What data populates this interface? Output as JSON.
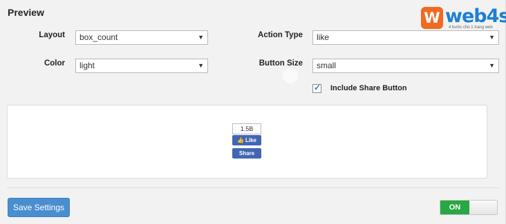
{
  "preview_title": "Preview",
  "logo": {
    "badge": "W",
    "text": "web4s",
    "tagline": "4 bước cho 1 trang web"
  },
  "fields": {
    "layout": {
      "label": "Layout",
      "value": "box_count"
    },
    "action_type": {
      "label": "Action Type",
      "value": "like"
    },
    "color": {
      "label": "Color",
      "value": "light"
    },
    "button_size": {
      "label": "Button Size",
      "value": "small"
    }
  },
  "include_share": {
    "label": "Include Share Button",
    "checked": true
  },
  "fb_widget": {
    "count": "1.5B",
    "like_label": "Like",
    "share_label": "Share"
  },
  "footer": {
    "save_label": "Save Settings",
    "toggle_label": "ON"
  },
  "colors": {
    "facebook_blue": "#4267b2",
    "save_button": "#4a8ed0",
    "toggle_on": "#28a745",
    "logo_orange": "#f06a22",
    "logo_blue": "#1d7fd6"
  },
  "icons": {
    "dropdown": "chevron-down-icon",
    "checkbox": "check-icon",
    "like": "thumbs-up-icon"
  }
}
